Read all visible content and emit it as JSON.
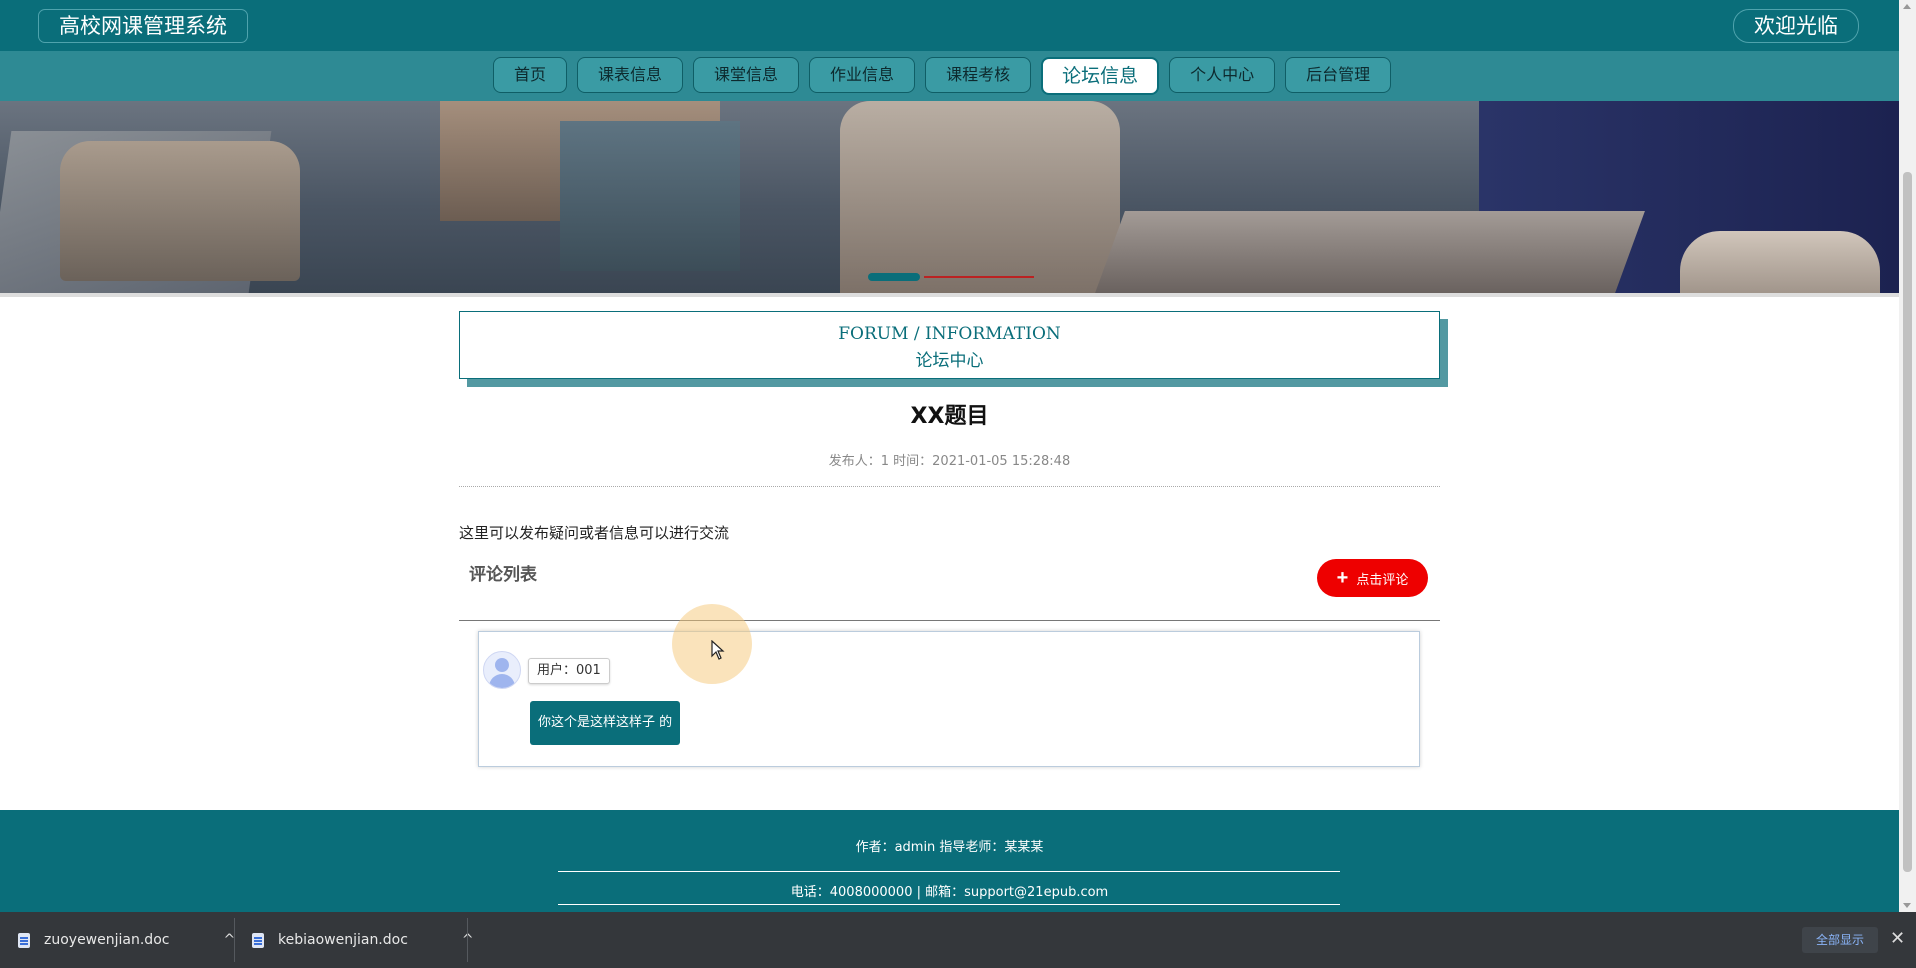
{
  "header": {
    "brand": "高校网课管理系统",
    "welcome": "欢迎光临"
  },
  "nav": {
    "items": [
      {
        "label": "首页"
      },
      {
        "label": "课表信息"
      },
      {
        "label": "课堂信息"
      },
      {
        "label": "作业信息"
      },
      {
        "label": "课程考核"
      },
      {
        "label": "论坛信息",
        "active": true
      },
      {
        "label": "个人中心"
      },
      {
        "label": "后台管理"
      }
    ]
  },
  "section": {
    "en": "FORUM / INFORMATION",
    "cn": "论坛中心"
  },
  "post": {
    "title": "XX题目",
    "meta": "发布人：1 时间：2021-01-05 15:28:48",
    "body": "这里可以发布疑问或者信息可以进行交流"
  },
  "comments": {
    "heading": "评论列表",
    "button_label": "点击评论",
    "items": [
      {
        "user": "用户：001",
        "text": "你这个是这样这样子 的"
      }
    ]
  },
  "footer": {
    "line1": "作者：admin 指导老师：某某某",
    "line2": "电话：4008000000 | 邮箱：support@21epub.com"
  },
  "downloads": {
    "items": [
      {
        "name": "zuoyewenjian.doc"
      },
      {
        "name": "kebiaowenjian.doc"
      }
    ],
    "show_all": "全部显示"
  },
  "colors": {
    "primary": "#0a6e7a",
    "nav": "#2e8a94",
    "accent_button": "#ee0000"
  }
}
